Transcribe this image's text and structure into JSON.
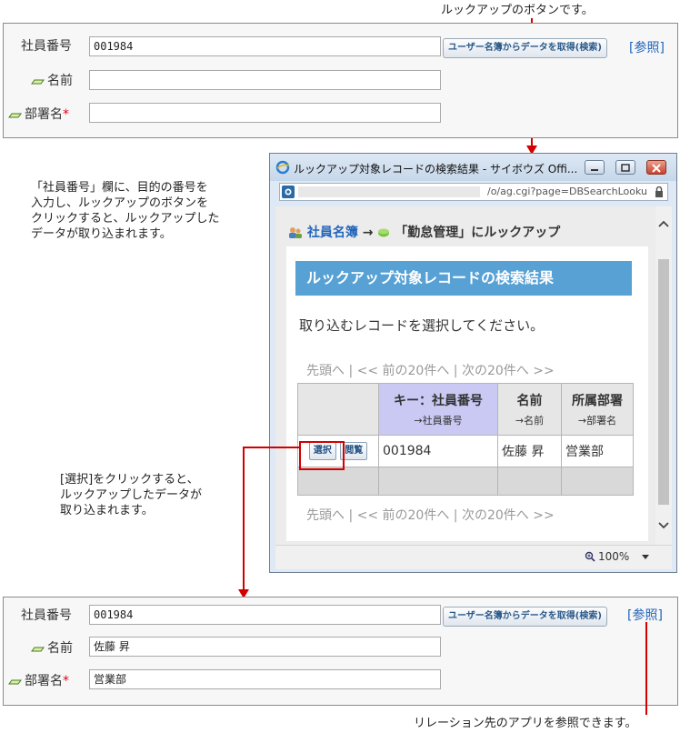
{
  "top_annotation": "ルックアップのボタンです。",
  "form_before": {
    "employee_no_label": "社員番号",
    "employee_no_value": "001984",
    "name_label": "名前",
    "name_value": "",
    "dept_label": "部署名",
    "dept_required_mark": "*",
    "lookup_button": "ユーザー名簿からデータを取得(検索)",
    "ref_link": "[参照]"
  },
  "note_left": {
    "line1": "「社員番号」欄に、目的の番号を",
    "line2": "入力し、ルックアップのボタンを",
    "line3": "クリックすると、ルックアップした",
    "line4": "データが取り込まれます。"
  },
  "popup": {
    "title": "ルックアップ対象レコードの検索結果 - サイボウズ Offi...",
    "address": "/o/ag.cgi?page=DBSearchLooku",
    "breadcrumb_app": "社員名簿",
    "breadcrumb_arrow": "→",
    "breadcrumb_rest": "「勤怠管理」にルックアップ",
    "banner": "ルックアップ対象レコードの検索結果",
    "instruction": "取り込むレコードを選択してください。",
    "pager_top": "先頭へ | << 前の20件へ |   次の20件へ >>",
    "pager_bottom": "先頭へ | << 前の20件へ |   次の20件へ >>",
    "col_key": "キー：社員番号",
    "col_key_sub": "→社員番号",
    "col_name": "名前",
    "col_name_sub": "→名前",
    "col_dept": "所属部署",
    "col_dept_sub": "→部署名",
    "select_button": "選択",
    "view_button": "閲覧",
    "row_key": "001984",
    "row_name": "佐藤 昇",
    "row_dept": "営業部",
    "zoom": "100%"
  },
  "note_select": {
    "line1": "[選択]をクリックすると、",
    "line2": "ルックアップしたデータが",
    "line3": "取り込まれます。"
  },
  "form_after": {
    "employee_no_label": "社員番号",
    "employee_no_value": "001984",
    "name_label": "名前",
    "name_value": "佐藤 昇",
    "dept_label": "部署名",
    "dept_required_mark": "*",
    "dept_value": "営業部",
    "lookup_button": "ユーザー名簿からデータを取得(検索)",
    "ref_link": "[参照]"
  },
  "bottom_annotation": "リレーション先のアプリを参照できます。",
  "colors": {
    "accent": "#57a1d5",
    "annotation_line": "#d40000",
    "link": "#2266bb",
    "required": "#e60012"
  }
}
